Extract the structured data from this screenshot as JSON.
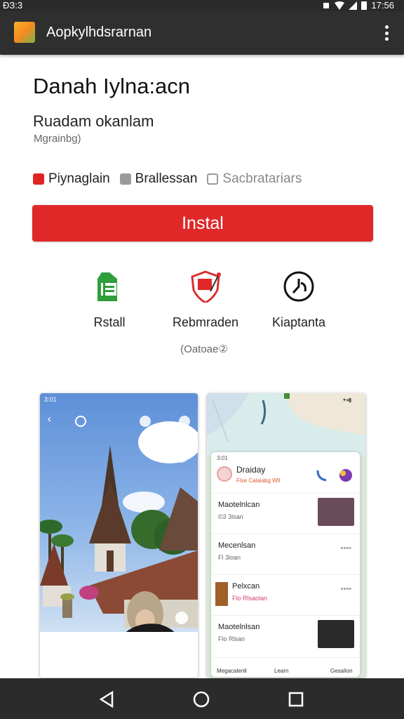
{
  "status_bar": {
    "time_left": "ĐЗ:3",
    "time_right": "17:56"
  },
  "app_bar": {
    "title": "Aopkylhdsrarnan"
  },
  "app": {
    "title": "Danah Iylnа:acn",
    "developer": "Ruadam okanlam",
    "category": "Mgrainbg)"
  },
  "badges": [
    {
      "label": "Piynaglain"
    },
    {
      "label": "Brallessan"
    },
    {
      "label": "Sacbratariars"
    }
  ],
  "install_label": "Instal",
  "actions": [
    {
      "label": "Rstall",
      "icon": "shopping-bag-icon"
    },
    {
      "label": "Rebmraden",
      "icon": "shield-flag-icon"
    },
    {
      "label": "Kiaptanta",
      "icon": "clock-icon"
    }
  ],
  "actions_note": "(Oatoae②",
  "screenshot_1": {
    "status": "3:01"
  },
  "screenshot_2": {
    "status": "3:01",
    "header_name": "Draiday",
    "header_sub": "Flse Calaiabg Wll",
    "rows": [
      {
        "name": "Maotelnlcan",
        "meta": "©3 3lsan"
      },
      {
        "name": "Mecenlsan",
        "meta": "Fl 3loan"
      },
      {
        "name": "Pelxcan",
        "meta": "Flo Rlsaolan"
      },
      {
        "name": "Maotelnlsan",
        "meta": "Flo Rlsan"
      }
    ],
    "nav": [
      "Megacalenll",
      "Learn",
      "Gesalion"
    ]
  },
  "colors": {
    "install_button": "#e02828",
    "app_bar": "#2f2f2f",
    "nav_bar": "#2b2b2b"
  }
}
